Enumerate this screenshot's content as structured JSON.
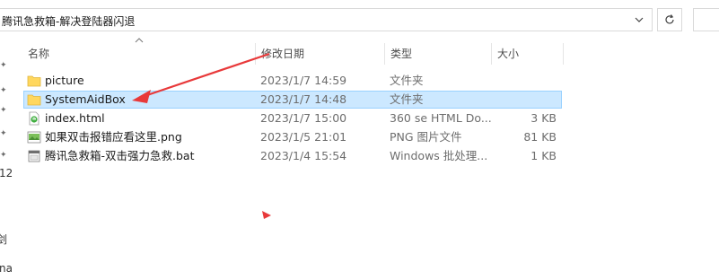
{
  "address": {
    "path": "腾讯急救箱-解决登陆器闪退"
  },
  "columns": {
    "name": "名称",
    "date": "修改日期",
    "type": "类型",
    "size": "大小"
  },
  "files": [
    {
      "name": "picture",
      "date": "2023/1/7 14:59",
      "type": "文件夹",
      "size": "",
      "icon": "folder-icon",
      "selected": false
    },
    {
      "name": "SystemAidBox",
      "date": "2023/1/7 14:48",
      "type": "文件夹",
      "size": "",
      "icon": "folder-icon",
      "selected": true
    },
    {
      "name": "index.html",
      "date": "2023/1/7 15:00",
      "type": "360 se HTML Do...",
      "size": "3 KB",
      "icon": "html-file-icon",
      "selected": false
    },
    {
      "name": "如果双击报错应看这里.png",
      "date": "2023/1/5 21:01",
      "type": "PNG 图片文件",
      "size": "81 KB",
      "icon": "png-file-icon",
      "selected": false
    },
    {
      "name": "腾讯急救箱-双击强力急救.bat",
      "date": "2023/1/4 15:54",
      "type": "Windows 批处理...",
      "size": "1 KB",
      "icon": "bat-file-icon",
      "selected": false
    }
  ],
  "nav_fragments": {
    "item1": "12",
    "item2": "剑",
    "item3": "na"
  },
  "colors": {
    "selection_bg": "#cce8ff",
    "selection_border": "#99d1ff",
    "folder": "#ffd75e",
    "annotation_arrow": "#e8393a"
  }
}
